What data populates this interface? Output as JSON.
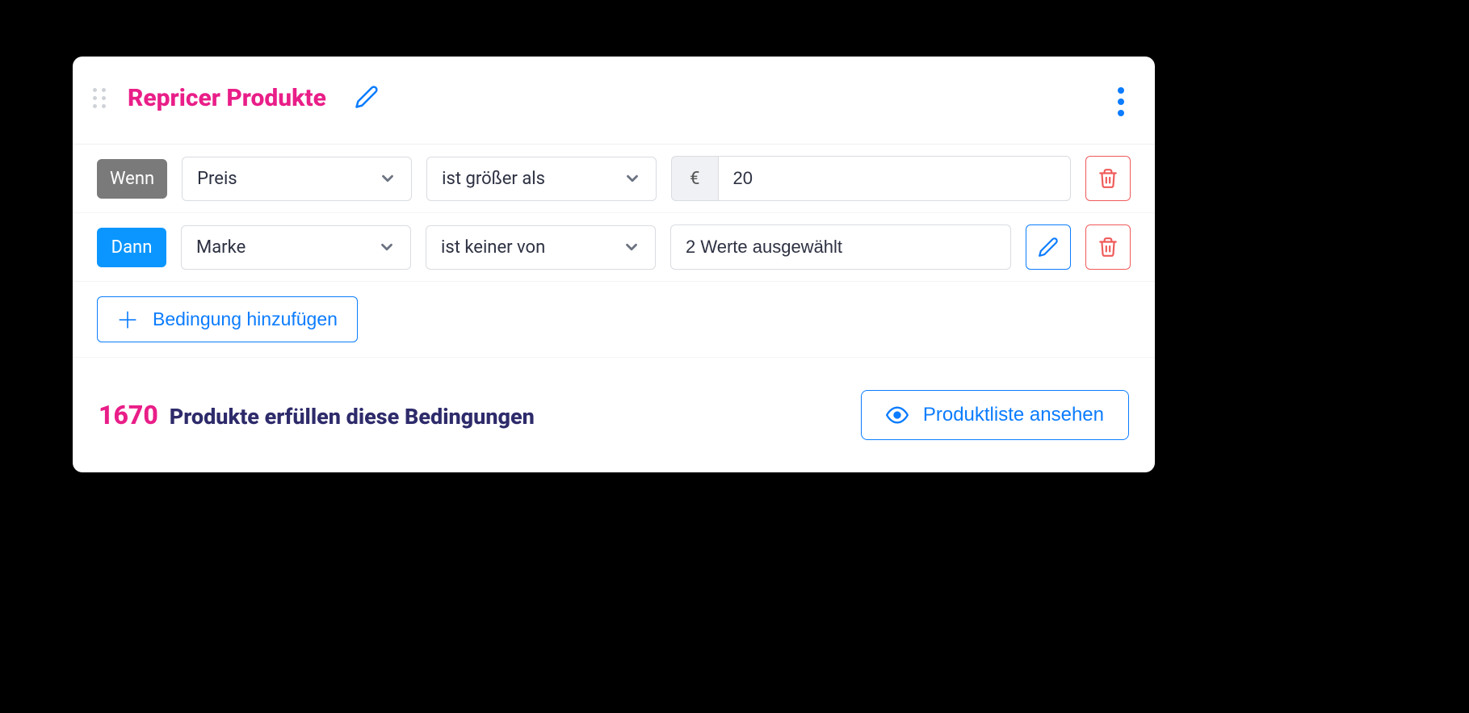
{
  "header": {
    "title": "Repricer Produkte"
  },
  "conditions": [
    {
      "badge": "Wenn",
      "badgeStyle": "grey",
      "field": "Preis",
      "operator": "ist größer als",
      "prefix": "€",
      "value": "20",
      "editable": false
    },
    {
      "badge": "Dann",
      "badgeStyle": "blue",
      "field": "Marke",
      "operator": "ist keiner von",
      "prefix": null,
      "value": "2 Werte ausgewählt",
      "editable": true
    }
  ],
  "addConditionLabel": "Bedingung hinzufügen",
  "result": {
    "count": "1670",
    "text": "Produkte erfüllen diese Bedingungen"
  },
  "viewListLabel": "Produktliste ansehen"
}
